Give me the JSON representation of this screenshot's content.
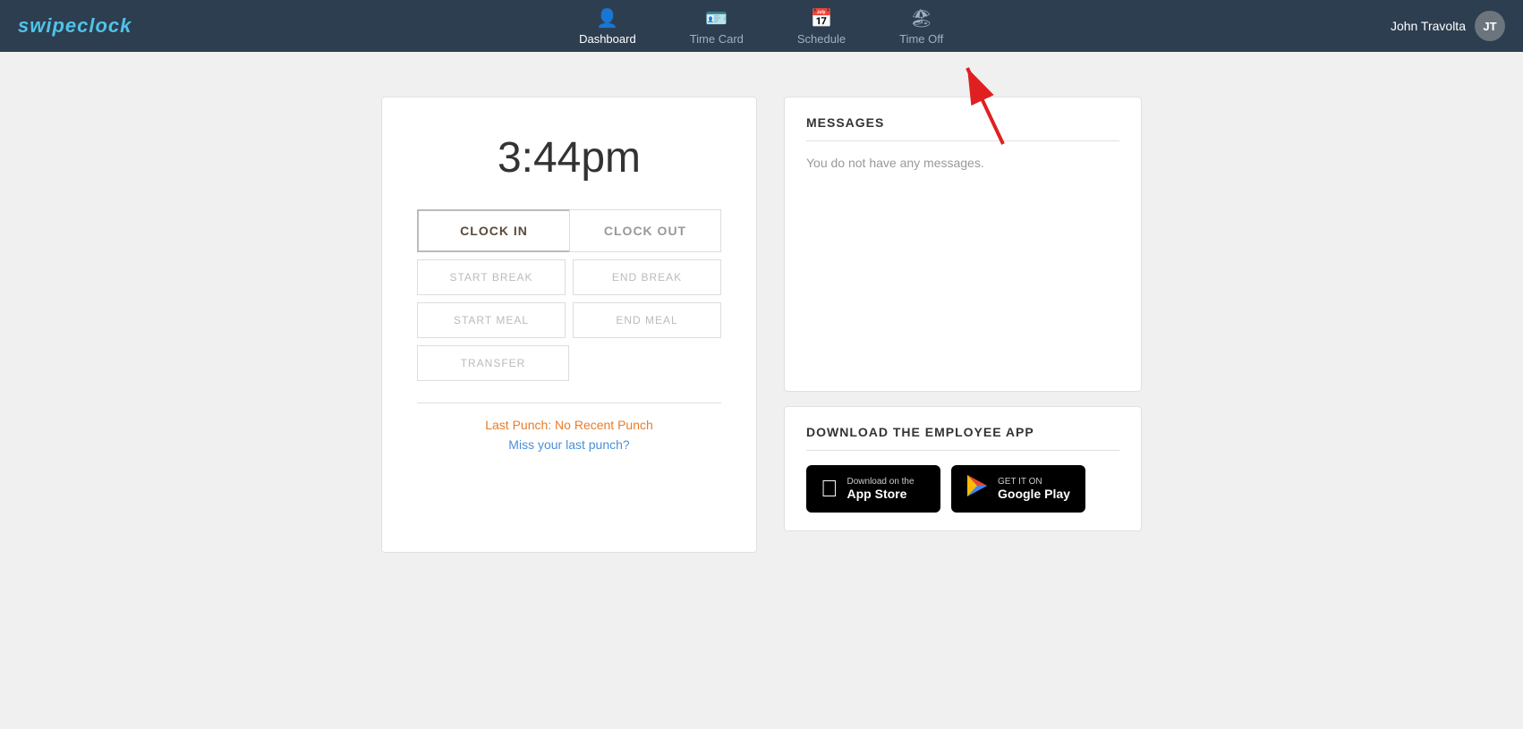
{
  "brand": {
    "name": "swipeclock"
  },
  "navbar": {
    "items": [
      {
        "id": "dashboard",
        "label": "Dashboard",
        "icon": "👤",
        "active": true
      },
      {
        "id": "timecard",
        "label": "Time Card",
        "icon": "🪪",
        "active": false
      },
      {
        "id": "schedule",
        "label": "Schedule",
        "icon": "📅",
        "active": false
      },
      {
        "id": "timeoff",
        "label": "Time Off",
        "icon": "🏖",
        "active": false
      }
    ],
    "user": {
      "name": "John Travolta",
      "initials": "JT"
    }
  },
  "clock": {
    "time": "3:44pm",
    "clock_in_label": "CLOCK IN",
    "clock_out_label": "CLOCK OUT",
    "start_break_label": "START BREAK",
    "end_break_label": "END BREAK",
    "start_meal_label": "START MEAL",
    "end_meal_label": "END MEAL",
    "transfer_label": "TRANSFER",
    "last_punch_label": "Last Punch: No Recent Punch",
    "miss_punch_label": "Miss your last punch?"
  },
  "messages": {
    "title": "MESSAGES",
    "empty_text": "You do not have any messages."
  },
  "download": {
    "title": "DOWNLOAD THE EMPLOYEE APP",
    "app_store": {
      "sub": "Download on the",
      "main": "App Store"
    },
    "google_play": {
      "sub": "GET IT ON",
      "main": "Google Play"
    }
  }
}
